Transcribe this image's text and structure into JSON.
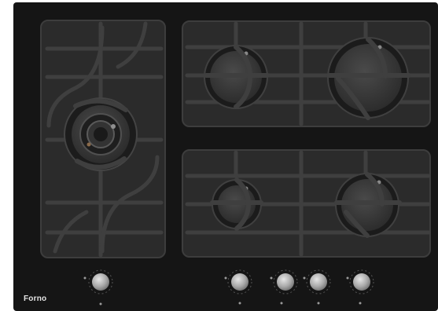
{
  "product": {
    "brand": "Forno"
  },
  "colors": {
    "glass": "#151515",
    "grate": "#2e2e2e",
    "grate_edge": "#434343",
    "burner": "#3a3a3a",
    "knob": "#b4b4b4"
  },
  "burners": [
    {
      "name": "wok-burner",
      "type": "triple-ring"
    },
    {
      "name": "rear-center-burner",
      "type": "standard"
    },
    {
      "name": "rear-right-burner",
      "type": "large"
    },
    {
      "name": "front-center-burner",
      "type": "small"
    },
    {
      "name": "front-right-burner",
      "type": "standard"
    }
  ],
  "knobs": [
    {
      "name": "knob-wok-burner"
    },
    {
      "name": "knob-front-center-burner"
    },
    {
      "name": "knob-rear-center-burner"
    },
    {
      "name": "knob-front-right-burner"
    },
    {
      "name": "knob-rear-right-burner"
    }
  ]
}
